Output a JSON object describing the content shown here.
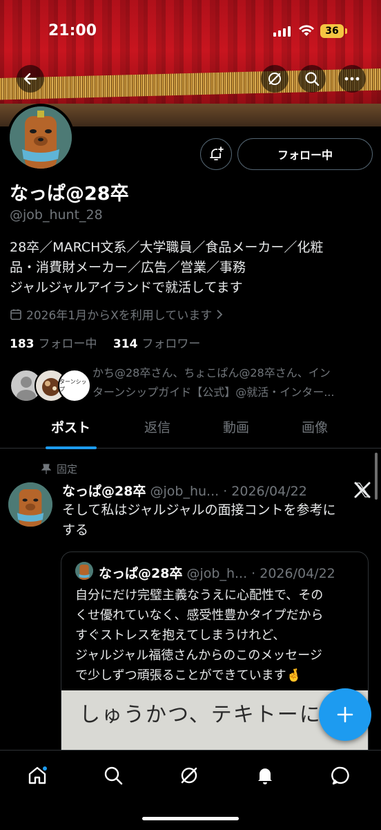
{
  "status_bar": {
    "time": "21:00",
    "battery": "36"
  },
  "profile": {
    "name": "なっぱ@28卒",
    "handle": "@job_hunt_28",
    "bio_lines": [
      "28卒／MARCH文系／大学職員／食品メーカー／化粧",
      "品・消費財メーカー／広告／営業／事務",
      "ジャルジャルアイランドで就活してます"
    ],
    "joined": "2026年1月からXを利用しています",
    "following_count": "183",
    "following_label": "フォロー中",
    "followers_count": "314",
    "followers_label": "フォロワー",
    "known_followers_line1": "かち@28卒さん、ちょこぱん@28卒さん、イン",
    "known_followers_line2": "ターンシップガイド【公式】@就活・インター...",
    "follow_button": "フォロー中",
    "mini_avatar_text": "ターンシップ"
  },
  "tabs": [
    "ポスト",
    "返信",
    "動画",
    "画像"
  ],
  "post": {
    "pinned_label": "固定",
    "author": "なっぱ@28卒",
    "handle_date": "@job_hu... · 2026/04/22",
    "text_lines": [
      "そして私はジャルジャルの面接コントを参考に",
      "する"
    ],
    "quote": {
      "author": "なっぱ@28卒",
      "handle_date": "@job_h... · 2026/04/22",
      "text_lines": [
        "自分にだけ完璧主義なうえに心配性で、その",
        "くせ優れていなく、感受性豊かタイプだから",
        "すぐストレスを抱えてしまうけれど、",
        "ジャルジャル福徳さんからのこのメッセージ",
        "で少しずつ頑張ることができています🤞"
      ],
      "image_handwriting": "しゅうかつ、テキトーに、"
    }
  },
  "icons": {
    "back": "back-arrow-icon",
    "grok": "grok-icon",
    "search": "search-icon",
    "more": "more-icon",
    "notify": "notification-add-icon",
    "calendar": "calendar-icon",
    "pin": "pin-icon",
    "x_logo": "x-logo-icon",
    "compose": "plus-icon",
    "nav": [
      "home-icon",
      "search-icon",
      "grok-icon",
      "bell-icon",
      "messages-icon"
    ]
  },
  "colors": {
    "accent": "#1d9bf0",
    "muted": "#71767b",
    "banner": "#c8151f"
  }
}
